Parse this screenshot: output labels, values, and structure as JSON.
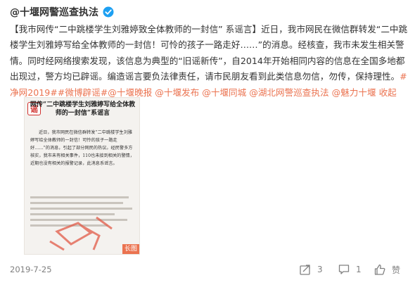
{
  "post": {
    "author": "@十堰网警巡查执法",
    "text_intro": "【我市网传“二中跳楼学生刘雅婷致全体教师的一封信” 系谣言】近日，我市网民在微信群转发“二中跳楼学生刘雅婷写给全体教师的一封信！可怜的孩子一路走好……”的消息。经核查，我市未发生相关警情。同时经网络搜索发现，该信息为典型的“旧谣新传”，自2014年开始相同内容的信息在全国多地都出现过，警方均已辟谣。编造谣言要负法律责任，请市民朋友看到此类信息勿信，勿传，保持理性。",
    "hashtags": [
      "#净网2019#",
      "#微博辟谣#"
    ],
    "mentions": [
      "@十堰晚报",
      "@十堰发布",
      "@十堰同城",
      "@湖北网警巡查执法",
      "@魅力十堰"
    ],
    "more_label": "收起"
  },
  "image": {
    "stamp": "谣",
    "doc_title": "网传“二中跳楼学生刘雅婷写给全体教师的一封信”系谣言",
    "doc_body": "近日，我市网民在微信群转发“二中跳楼学生刘雅婷写给全体教师的一封信！可怜的孩子一路走好……”的消息，引起了部分网民的热议。经民警多方核实，我市未有相关事件，110也未接到相关的警情，近期也没有相关的报警记录，此消息系谣言。",
    "badge": "长图"
  },
  "footer": {
    "date": "2019-7-25",
    "share_count": "3",
    "comment_count": "1",
    "like_label": "赞"
  },
  "colors": {
    "link": "#eb7350",
    "text": "#333333",
    "muted": "#808080",
    "verified": "#1da0f2",
    "stamp": "#d0302d"
  },
  "icons": [
    "verified-icon",
    "share-icon",
    "comment-icon",
    "like-icon"
  ]
}
